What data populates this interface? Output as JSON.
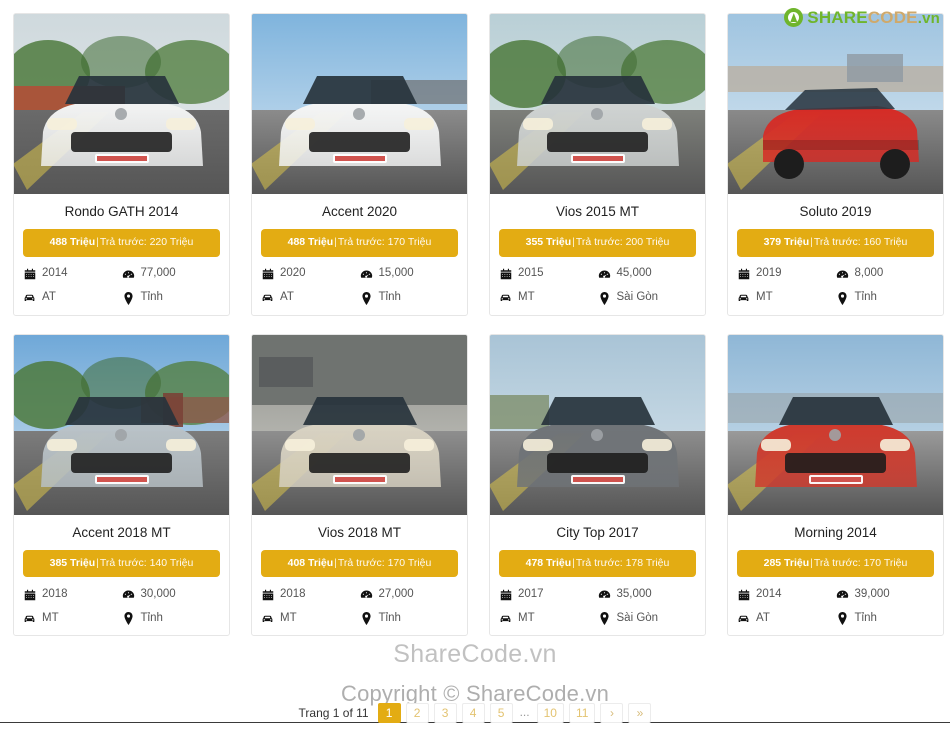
{
  "brand": {
    "mark_icon": "sharecode-recycle-icon",
    "part_share": "SHARE",
    "part_code": "CODE",
    "part_tld": ".vn",
    "color_green": "#6fb52c",
    "color_tan": "#cfa96b"
  },
  "theme": {
    "accent": "#e3ac13",
    "card_border": "#e6e6e6",
    "text": "#222222",
    "muted": "#555555"
  },
  "watermarks": {
    "center": "ShareCode.vn",
    "copyright": "Copyright © ShareCode.vn"
  },
  "labels": {
    "price_separator": "|",
    "deposit_prefix": "Trả trước:"
  },
  "cards": [
    {
      "title": "Rondo GATH 2014",
      "price": "488 Triệu",
      "deposit": "Trả trước: 220 Triệu",
      "year": "2014",
      "mileage": "77,000",
      "transmission": "AT",
      "location": "Tỉnh",
      "photo": "kia-rondo-white-front"
    },
    {
      "title": "Accent 2020",
      "price": "488 Triệu",
      "deposit": "Trả trước: 170 Triệu",
      "year": "2020",
      "mileage": "15,000",
      "transmission": "AT",
      "location": "Tỉnh",
      "photo": "hyundai-accent-white-front"
    },
    {
      "title": "Vios 2015 MT",
      "price": "355 Triệu",
      "deposit": "Trả trước: 200 Triệu",
      "year": "2015",
      "mileage": "45,000",
      "transmission": "MT",
      "location": "Sài Gòn",
      "photo": "toyota-vios-silver-front"
    },
    {
      "title": "Soluto 2019",
      "price": "379 Triệu",
      "deposit": "Trả trước: 160 Triệu",
      "year": "2019",
      "mileage": "8,000",
      "transmission": "MT",
      "location": "Tỉnh",
      "photo": "kia-soluto-red-angle"
    },
    {
      "title": "Accent 2018 MT",
      "price": "385 Triệu",
      "deposit": "Trả trước: 140 Triệu",
      "year": "2018",
      "mileage": "30,000",
      "transmission": "MT",
      "location": "Tỉnh",
      "photo": "hyundai-accent-silver-front"
    },
    {
      "title": "Vios 2018 MT",
      "price": "408 Triệu",
      "deposit": "Trả trước: 170 Triệu",
      "year": "2018",
      "mileage": "27,000",
      "transmission": "MT",
      "location": "Tỉnh",
      "photo": "toyota-vios-beige-front"
    },
    {
      "title": "City Top 2017",
      "price": "478 Triệu",
      "deposit": "Trả trước: 178 Triệu",
      "year": "2017",
      "mileage": "35,000",
      "transmission": "MT",
      "location": "Sài Gòn",
      "photo": "honda-city-grey-front"
    },
    {
      "title": "Morning 2014",
      "price": "285 Triệu",
      "deposit": "Trả trước: 170 Triệu",
      "year": "2014",
      "mileage": "39,000",
      "transmission": "AT",
      "location": "Tỉnh",
      "photo": "kia-morning-red-front"
    }
  ],
  "pagination": {
    "status": "Trang 1 of 11",
    "items": [
      {
        "label": "1",
        "active": true,
        "kind": "page"
      },
      {
        "label": "2",
        "active": false,
        "kind": "page"
      },
      {
        "label": "3",
        "active": false,
        "kind": "page"
      },
      {
        "label": "4",
        "active": false,
        "kind": "page"
      },
      {
        "label": "5",
        "active": false,
        "kind": "page"
      },
      {
        "label": "...",
        "active": false,
        "kind": "ellipsis"
      },
      {
        "label": "10",
        "active": false,
        "kind": "page"
      },
      {
        "label": "11",
        "active": false,
        "kind": "page"
      },
      {
        "label": "›",
        "active": false,
        "kind": "next"
      },
      {
        "label": "»",
        "active": false,
        "kind": "last"
      }
    ]
  }
}
